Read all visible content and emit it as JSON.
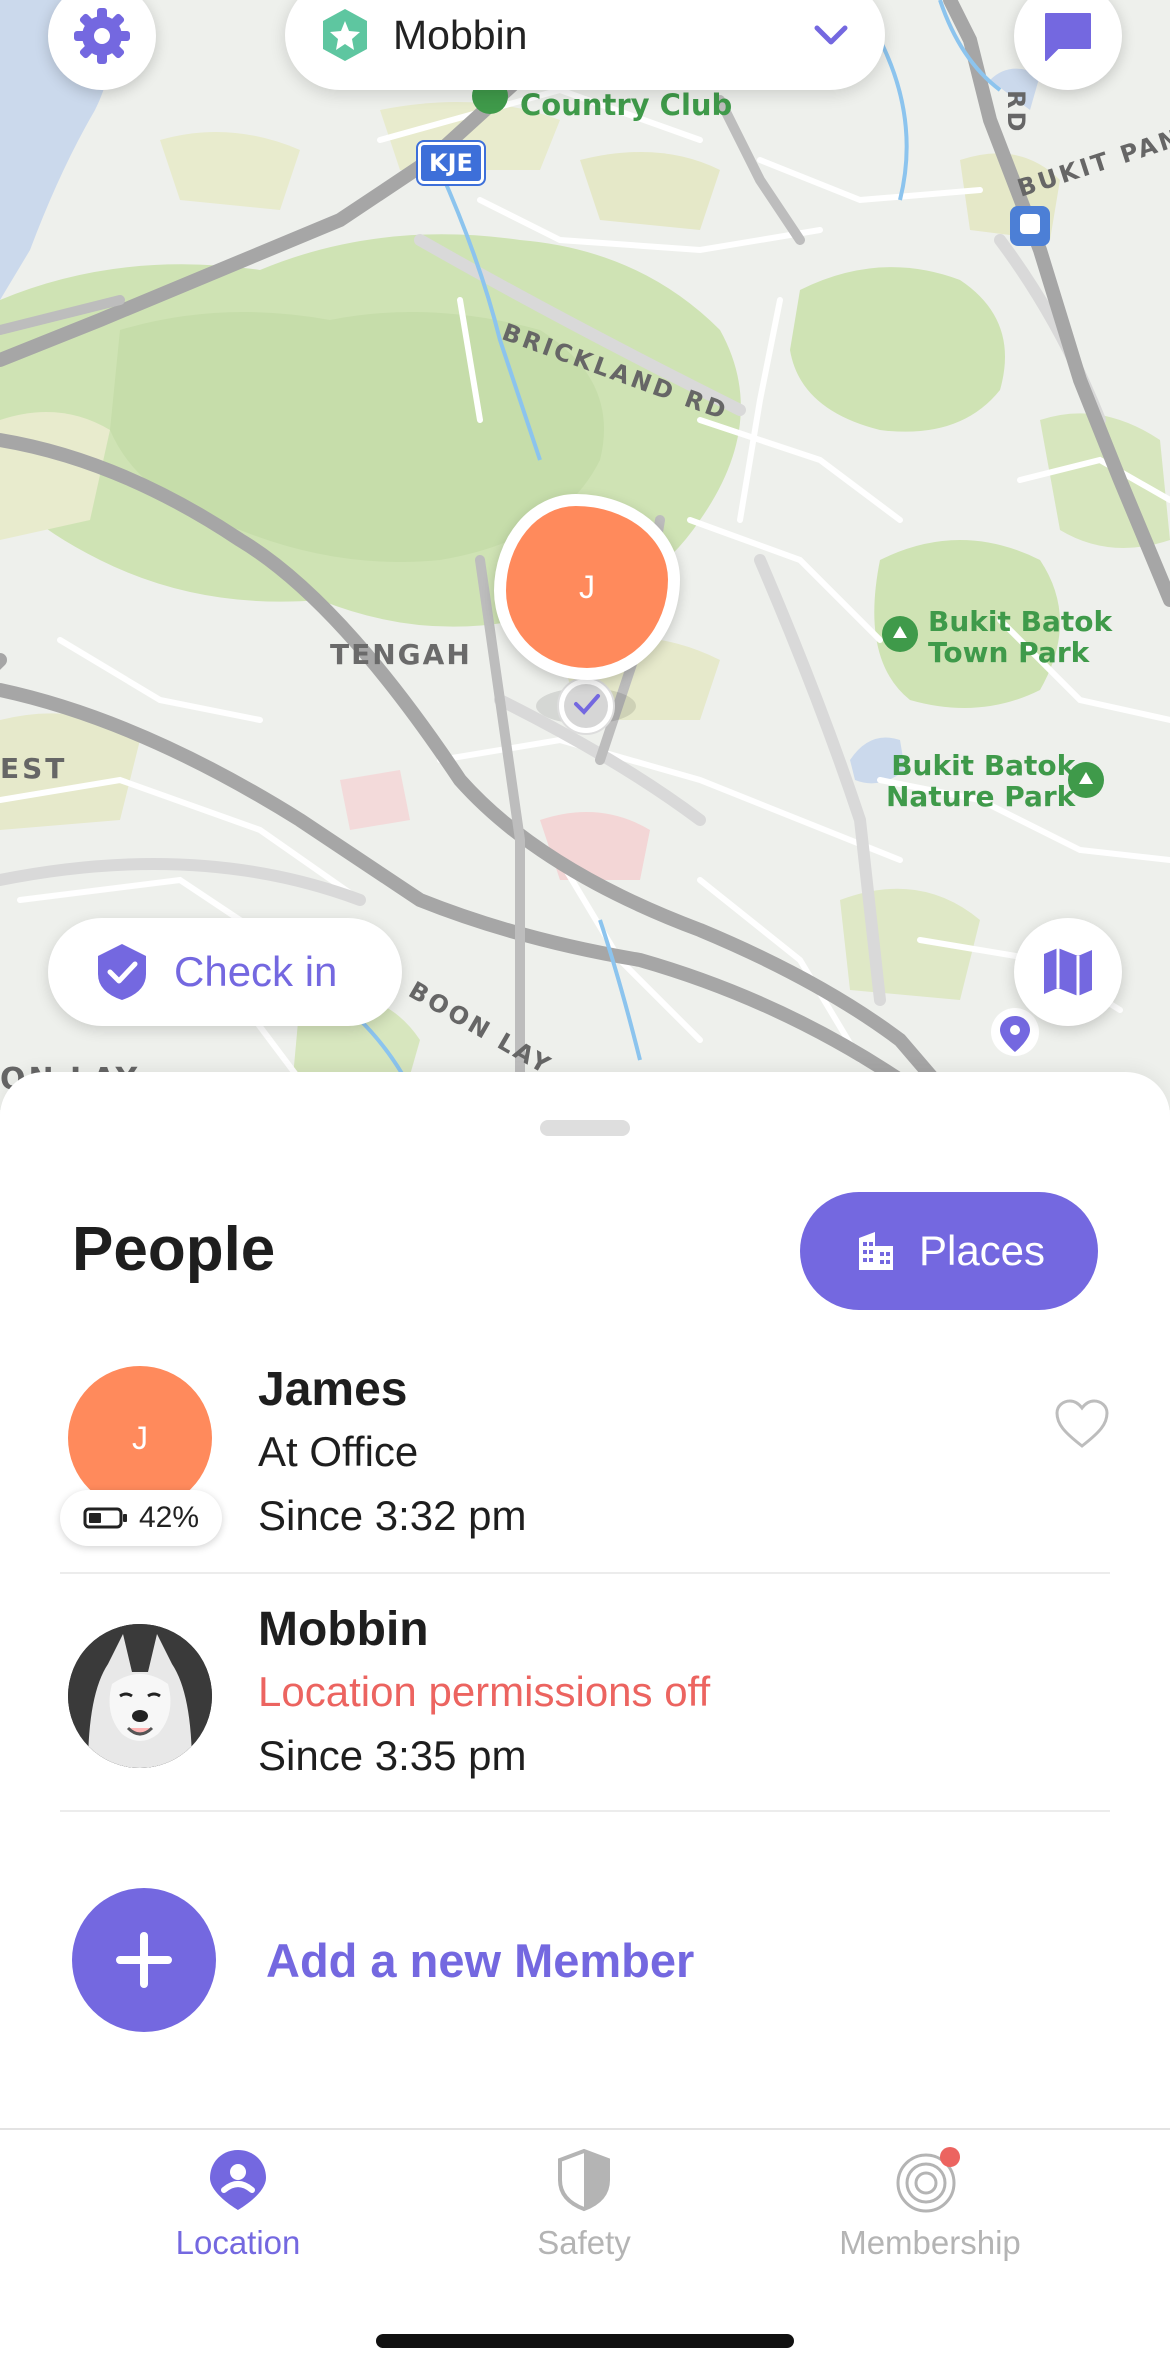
{
  "header": {
    "circle_name": "Mobbin",
    "settings_icon": "gear-icon",
    "chat_icon": "chat-bubble-icon",
    "dropdown_icon": "chevron-down-icon",
    "circle_icon": "star-badge-icon"
  },
  "map": {
    "labels": {
      "country_club": "Country Club",
      "kje": "KJE",
      "brickland": "BRICKLAND RD",
      "bukit_panjang": "BUKIT PANJ",
      "rd": "RD",
      "tengah": "TENGAH",
      "bukit_batok_town_park_1": "Bukit Batok",
      "bukit_batok_town_park_2": "Town Park",
      "bukit_batok_nature_park_1": "Bukit Batok",
      "bukit_batok_nature_park_2": "Nature Park",
      "est": "EST",
      "boon_lay": "BOON LAY",
      "on_lay": "ON LAY"
    },
    "pin_initial": "J",
    "check_in_label": "Check in"
  },
  "sheet": {
    "title": "People",
    "places_label": "Places",
    "members": [
      {
        "initial": "J",
        "name": "James",
        "status": "At Office",
        "since": "Since 3:32 pm",
        "battery": "42%"
      },
      {
        "name": "Mobbin",
        "status": "Location permissions off",
        "since": "Since 3:35 pm"
      }
    ],
    "add_member_label": "Add a new Member"
  },
  "tabs": [
    {
      "label": "Location",
      "icon": "person-pin-icon",
      "active": true
    },
    {
      "label": "Safety",
      "icon": "shield-icon",
      "active": false
    },
    {
      "label": "Membership",
      "icon": "membership-icon",
      "active": false
    }
  ],
  "colors": {
    "accent": "#7468e0",
    "avatar_orange": "#ff8a5c",
    "warning": "#ec6460",
    "park_green": "#3f9a4a"
  }
}
